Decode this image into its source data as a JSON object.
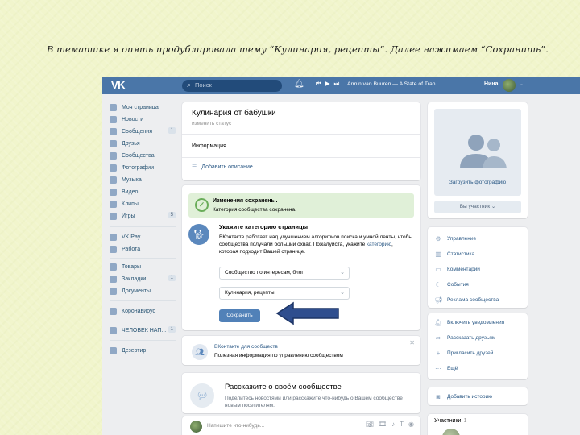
{
  "caption": "В тематике я опять продублировала тему “Кулинария, рецепты”. Далее нажимаем “Сохранить”.",
  "colors": {
    "vk_blue": "#4a76a8",
    "button_blue": "#5181b8",
    "success_bg": "#e0f0d8",
    "arrow_fill": "#2f4e8e"
  },
  "topbar": {
    "logo": "VK",
    "search_placeholder": "Поиск",
    "track": "Armin van Buuren — A State of Tran...",
    "user_name": "Нина",
    "icons": [
      "search-icon",
      "bell-icon",
      "prev-icon",
      "play-icon",
      "next-icon"
    ]
  },
  "menu": [
    {
      "label": "Моя страница",
      "icon": "user-icon"
    },
    {
      "label": "Новости",
      "icon": "news-icon"
    },
    {
      "label": "Сообщения",
      "icon": "message-icon",
      "count": "1"
    },
    {
      "label": "Друзья",
      "icon": "friends-icon"
    },
    {
      "label": "Сообщества",
      "icon": "groups-icon"
    },
    {
      "label": "Фотографии",
      "icon": "camera-icon"
    },
    {
      "label": "Музыка",
      "icon": "music-icon"
    },
    {
      "label": "Видео",
      "icon": "video-icon"
    },
    {
      "label": "Клипы",
      "icon": "clips-icon"
    },
    {
      "label": "Игры",
      "icon": "games-icon",
      "count": "5"
    },
    {
      "label": "VK Pay",
      "icon": "vkpay-icon"
    },
    {
      "label": "Работа",
      "icon": "work-icon"
    },
    {
      "label": "Товары",
      "icon": "goods-icon"
    },
    {
      "label": "Закладки",
      "icon": "bookmark-icon",
      "count": "1"
    },
    {
      "label": "Документы",
      "icon": "docs-icon"
    },
    {
      "label": "Коронавирус",
      "icon": "corona-icon"
    },
    {
      "label": "ЧЕЛОВЕК НАП...",
      "icon": "group-icon",
      "count": "1"
    },
    {
      "label": "Дезертир",
      "icon": "app-icon"
    }
  ],
  "group": {
    "name": "Кулинария от бабушки",
    "status": "изменить статус",
    "info_label": "Информация",
    "add_description": "Добавить описание"
  },
  "category": {
    "success_title": "Изменения сохранены.",
    "success_text": "Категория сообщества сохранена.",
    "title": "Укажите категорию страницы",
    "desc_before": "ВКонтакте работает над улучшением алгоритмов поиска и умной ленты, чтобы сообщества получали больший охват. Пожалуйста, укажите ",
    "desc_link": "категорию",
    "desc_after": ", которая подходит Вашей странице.",
    "select1": "Сообщество по интересам, блог",
    "select2": "Кулинария, рецепты",
    "save_button": "Сохранить"
  },
  "vk_for_communities": {
    "title": "ВКонтакте для сообществ",
    "desc": "Полезная информация по управлению сообществом"
  },
  "tell": {
    "title": "Расскажите о своём сообществе",
    "desc": "Поделитесь новостями или расскажите что-нибудь о Вашем сообществе новым посетителям.",
    "post_placeholder": "Напишите что-нибудь..."
  },
  "sidebar": {
    "upload_photo": "Загрузить фотографию",
    "member_button": "Вы участник ⌄",
    "manage": [
      {
        "label": "Управление",
        "icon": "gear-icon"
      },
      {
        "label": "Статистика",
        "icon": "stats-icon"
      },
      {
        "label": "Комментарии",
        "icon": "comment-icon"
      },
      {
        "label": "События",
        "icon": "events-icon"
      },
      {
        "label": "Реклама сообщества",
        "icon": "megaphone-icon"
      }
    ],
    "actions": [
      {
        "label": "Включить уведомления",
        "icon": "bell-icon"
      },
      {
        "label": "Рассказать друзьям",
        "icon": "share-icon"
      },
      {
        "label": "Пригласить друзей",
        "icon": "invite-icon"
      },
      {
        "label": "Ещё",
        "icon": "more-icon"
      }
    ],
    "add_story": "Добавить историю",
    "members_title": "Участники",
    "members_count": "1"
  }
}
